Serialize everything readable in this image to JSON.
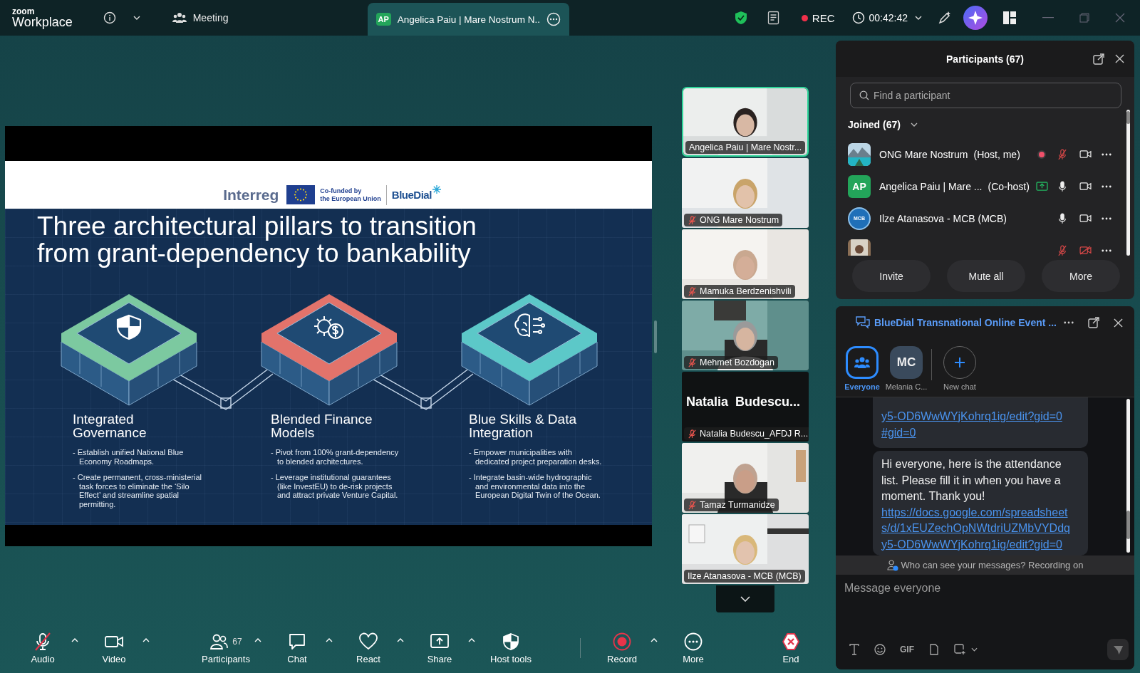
{
  "app": {
    "logo_top": "zoom",
    "logo_bottom": "Workplace"
  },
  "top_bar": {
    "meeting_label": "Meeting",
    "tab": {
      "badge": "AP",
      "title": "Angelica Paiu | Mare Nostrum N.."
    },
    "rec_label": "REC",
    "timer": "00:42:42"
  },
  "slide": {
    "logos": {
      "interreg": "Interreg",
      "eu_line1": "Co-funded by",
      "eu_line2": "the European Union",
      "bluedial": "BlueDial"
    },
    "title": "Three architectural pillars to transition\nfrom grant-dependency to bankability",
    "pillars": [
      {
        "kind": "shield",
        "color": "#7cc9a0",
        "heading": "Integrated\nGovernance",
        "bullets": [
          "- Establish unified National Blue Economy Roadmaps.",
          "- Create permanent, cross-ministerial task forces to eliminate the ‘Silo Effect’ and streamline spatial permitting."
        ]
      },
      {
        "kind": "finance",
        "color": "#e2736b",
        "heading": "Blended Finance\nModels",
        "bullets": [
          "- Pivot from 100% grant-dependency to blended architectures.",
          "- Leverage institutional guarantees (like InvestEU) to de-risk projects and attract private Venture Capital."
        ]
      },
      {
        "kind": "brain",
        "color": "#5cc8c8",
        "heading": "Blue Skills & Data\nIntegration",
        "bullets": [
          "- Empower municipalities with dedicated project preparation desks.",
          "- Integrate basin-wide hydrographic and environmental data into the European Digital Twin of the Ocean."
        ]
      }
    ]
  },
  "video_tiles": [
    {
      "kind": "camera",
      "name": "Angelica Paiu | Mare Nostr...",
      "speaking": true,
      "muted": false
    },
    {
      "kind": "camera",
      "name": "ONG Mare Nostrum",
      "speaking": false,
      "muted": true
    },
    {
      "kind": "camera",
      "name": "Mamuka Berdzenishvili",
      "speaking": false,
      "muted": true
    },
    {
      "kind": "camera",
      "name": "Mehmet Bozdogan",
      "speaking": false,
      "muted": true
    },
    {
      "kind": "name_card",
      "display_name": "Natalia  Budescu...",
      "name": "Natalia Budescu_AFDJ R...",
      "speaking": false,
      "muted": true
    },
    {
      "kind": "camera",
      "name": "Tamaz Turmanidze",
      "speaking": false,
      "muted": true
    },
    {
      "kind": "camera",
      "name": "Ilze Atanasova - MCB (MCB)",
      "speaking": false,
      "muted": false
    }
  ],
  "participants": {
    "title": "Participants (67)",
    "search_placeholder": "Find a participant",
    "group_label": "Joined (67)",
    "group_expanded": true,
    "rows": [
      {
        "kind": "picture",
        "name": "ONG Mare Nostrum",
        "role": "(Host, me)",
        "recording": true,
        "sharing": false,
        "muted": true,
        "video_off": false
      },
      {
        "kind": "initials",
        "initials": "AP",
        "name": "Angelica Paiu | Mare ...",
        "role": "(Co-host)",
        "recording": false,
        "sharing": true,
        "muted": false,
        "video_off": false
      },
      {
        "kind": "logo",
        "logo_text": "MCB",
        "name": "Ilze Atanasova - MCB (MCB)",
        "recording": false,
        "sharing": false,
        "muted": false,
        "video_off": false
      },
      {
        "kind": "picture",
        "recording": false,
        "sharing": false,
        "muted": true,
        "video_off": true
      }
    ],
    "buttons": [
      "Invite",
      "Mute all",
      "More"
    ]
  },
  "chat": {
    "title": "BlueDial Transnational Online Event ...",
    "recipients": [
      {
        "kind": "group",
        "label": "Everyone",
        "selected": true
      },
      {
        "kind": "initials",
        "initials": "MC",
        "label": "Melania C...",
        "selected": false
      },
      {
        "kind": "new",
        "label": "New chat",
        "selected": false
      }
    ],
    "messages": [
      {
        "link": "y5-OD6WwWYjKohrq1ig/edit?gid=0#gid=0"
      },
      {
        "text": "Hi everyone, here is the attendance list. Please fill it in when you have a moment. Thank you!",
        "link": "https://docs.google.com/spreadsheets/d/1xEUZechOpNWtdriUZMbVYDdqy5-OD6WwWYjKohrq1ig/edit?gid=0"
      }
    ],
    "notice": "Who can see your messages? Recording on",
    "placeholder": "Message everyone",
    "gif_label": "GIF"
  },
  "toolbar": [
    {
      "divider": false,
      "items": [
        {
          "kind": "audio",
          "label": "Audio",
          "muted": true,
          "caret": true
        },
        {
          "kind": "video",
          "label": "Video",
          "caret": true
        }
      ]
    },
    {
      "divider": false,
      "items": [
        {
          "kind": "participants",
          "label": "Participants",
          "count": "67",
          "caret": true
        },
        {
          "kind": "chat",
          "label": "Chat",
          "caret": true
        },
        {
          "kind": "react",
          "label": "React",
          "caret": true
        },
        {
          "kind": "share",
          "label": "Share",
          "caret": true
        },
        {
          "kind": "host",
          "label": "Host tools",
          "caret": false
        }
      ]
    },
    {
      "divider": true,
      "items": [
        {
          "kind": "record",
          "label": "Record",
          "on": true,
          "caret": true
        },
        {
          "kind": "more",
          "label": "More",
          "caret": false
        }
      ]
    },
    {
      "divider": false,
      "items": [
        {
          "kind": "end",
          "label": "End",
          "caret": false
        }
      ]
    }
  ]
}
